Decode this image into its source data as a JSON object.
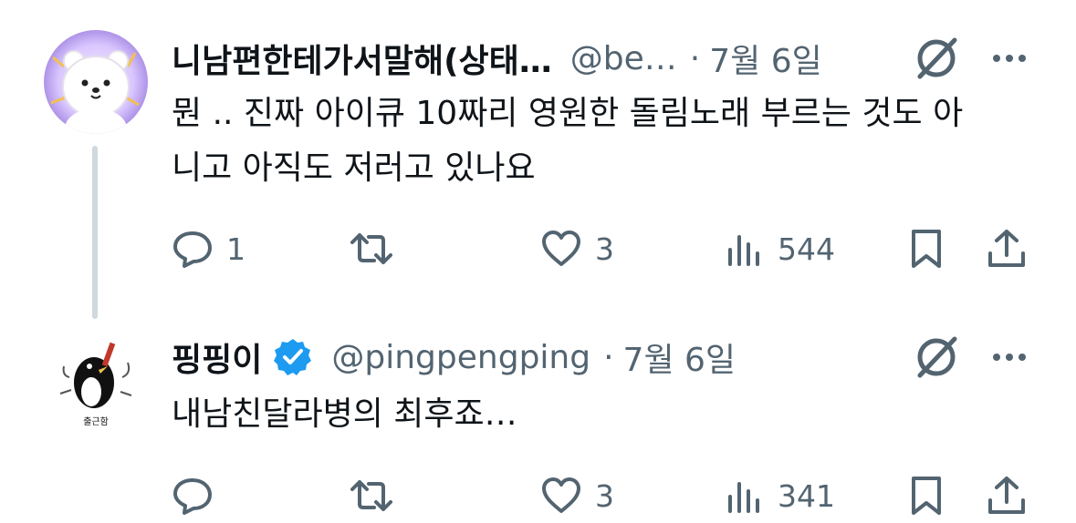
{
  "tweets": [
    {
      "name": "니남편한테가서말해(상태…",
      "handle": "@be…",
      "separator": "·",
      "date": "7월 6일",
      "text_line1": "뭔 .. 진짜 아이큐 10짜리 영원한 돌림노래 부르는 것도 아",
      "text_line2": "니고 아직도 저러고 있나요",
      "reply_count": "1",
      "like_count": "3",
      "view_count": "544"
    },
    {
      "name": "핑핑이",
      "handle": "@pingpengping",
      "separator": "·",
      "date": "7월 6일",
      "text_line1": "내남친달라병의 최후죠…",
      "avatar_caption": "출근함",
      "reply_count": "",
      "like_count": "3",
      "view_count": "341"
    }
  ],
  "colors": {
    "text": "#0f1419",
    "secondary": "#536471",
    "verified": "#1d9bf0",
    "thread_line": "#cfd9de"
  },
  "icons": [
    "reply-icon",
    "retweet-icon",
    "like-icon",
    "views-icon",
    "bookmark-icon",
    "share-icon",
    "grok-icon",
    "more-icon",
    "verified-badge-icon"
  ]
}
